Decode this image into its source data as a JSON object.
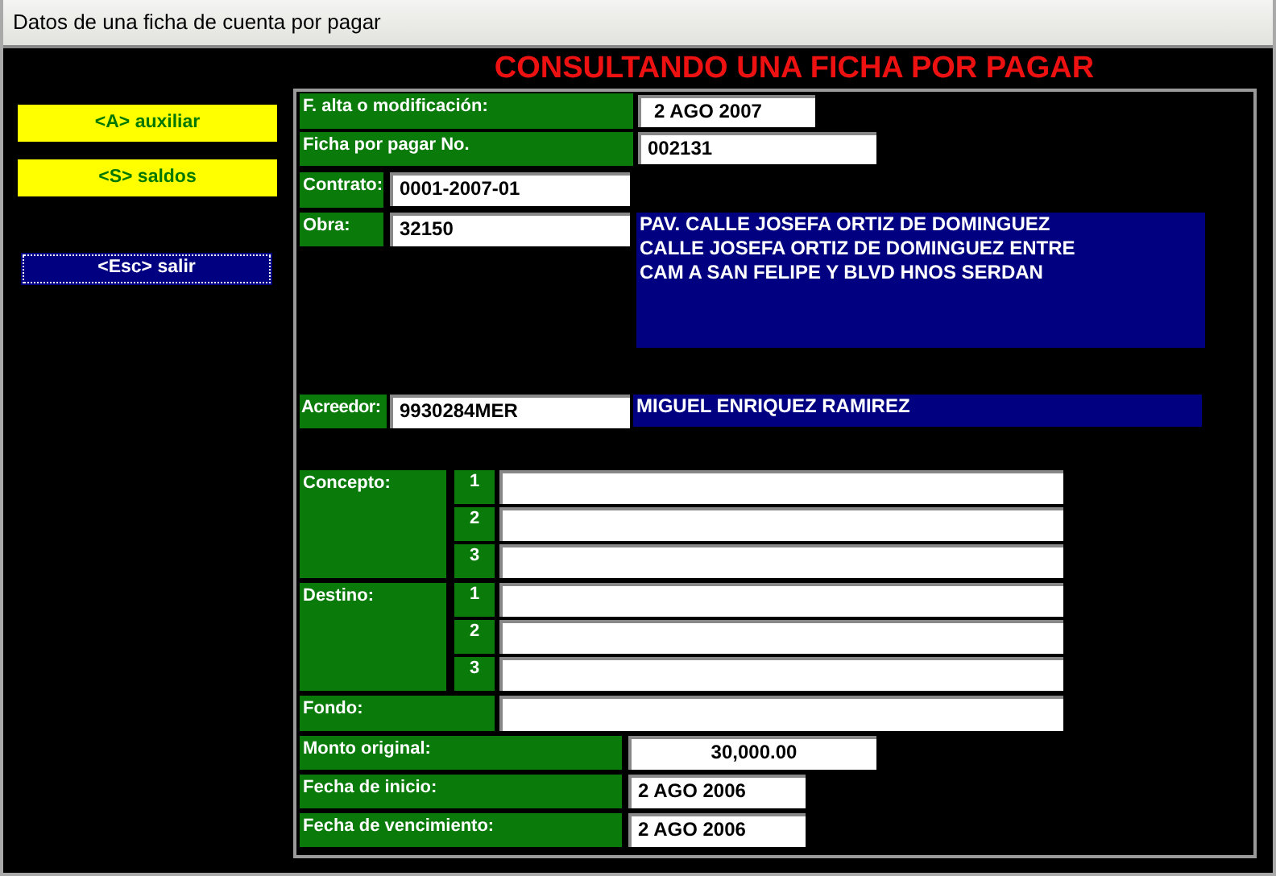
{
  "window": {
    "title": "Datos de una ficha de cuenta por pagar"
  },
  "heading": "CONSULTANDO UNA FICHA POR PAGAR",
  "side_buttons": [
    {
      "label": "<A> auxiliar",
      "focused": false
    },
    {
      "label": "<S> saldos",
      "focused": false
    },
    {
      "label": "<Esc> salir",
      "focused": true
    }
  ],
  "form": {
    "fecha_alta": {
      "label": "F. alta o modificación:",
      "value": "2 AGO 2007"
    },
    "ficha": {
      "label": "Ficha por pagar No.",
      "value": "002131"
    },
    "contrato": {
      "label": "Contrato:",
      "value": "0001-2007-01"
    },
    "obra": {
      "label": "Obra:",
      "value": "32150",
      "description": "PAV. CALLE JOSEFA ORTIZ DE DOMINGUEZ\nCALLE JOSEFA ORTIZ DE DOMINGUEZ ENTRE\nCAM A SAN FELIPE Y BLVD HNOS SERDAN"
    },
    "acreedor": {
      "label": "Acreedor:",
      "value": "9930284MER",
      "name": "MIGUEL ENRIQUEZ RAMIREZ"
    },
    "concepto": {
      "label": "Concepto:",
      "lines": [
        {
          "number": "1"
        },
        {
          "number": "2"
        },
        {
          "number": "3"
        }
      ]
    },
    "destino": {
      "label": "Destino:",
      "lines": [
        {
          "number": "1"
        },
        {
          "number": "2"
        },
        {
          "number": "3"
        }
      ]
    },
    "fondo": {
      "label": "Fondo:"
    },
    "monto": {
      "label": "Monto original:",
      "value": "30,000.00"
    },
    "fecha_inicio": {
      "label": "Fecha de inicio:",
      "value": "2 AGO 2006"
    },
    "fecha_vencimiento": {
      "label": "Fecha de vencimiento:",
      "value": "2 AGO 2006"
    }
  }
}
